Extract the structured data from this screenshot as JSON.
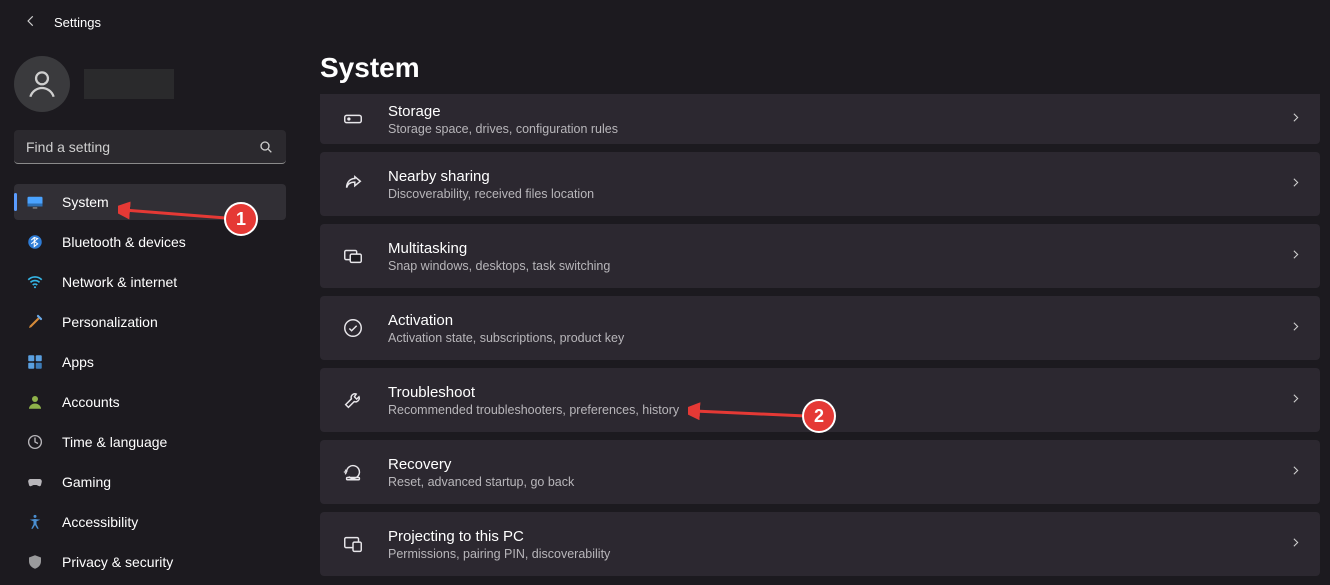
{
  "header": {
    "title": "Settings"
  },
  "user": {
    "name": ""
  },
  "search": {
    "placeholder": "Find a setting"
  },
  "sidebar": {
    "items": [
      {
        "label": "System",
        "active": true
      },
      {
        "label": "Bluetooth & devices"
      },
      {
        "label": "Network & internet"
      },
      {
        "label": "Personalization"
      },
      {
        "label": "Apps"
      },
      {
        "label": "Accounts"
      },
      {
        "label": "Time & language"
      },
      {
        "label": "Gaming"
      },
      {
        "label": "Accessibility"
      },
      {
        "label": "Privacy & security"
      }
    ]
  },
  "main": {
    "title": "System",
    "rows": [
      {
        "title": "Storage",
        "sub": "Storage space, drives, configuration rules"
      },
      {
        "title": "Nearby sharing",
        "sub": "Discoverability, received files location"
      },
      {
        "title": "Multitasking",
        "sub": "Snap windows, desktops, task switching"
      },
      {
        "title": "Activation",
        "sub": "Activation state, subscriptions, product key"
      },
      {
        "title": "Troubleshoot",
        "sub": "Recommended troubleshooters, preferences, history"
      },
      {
        "title": "Recovery",
        "sub": "Reset, advanced startup, go back"
      },
      {
        "title": "Projecting to this PC",
        "sub": "Permissions, pairing PIN, discoverability"
      }
    ]
  },
  "annotations": {
    "badge1": "1",
    "badge2": "2"
  }
}
